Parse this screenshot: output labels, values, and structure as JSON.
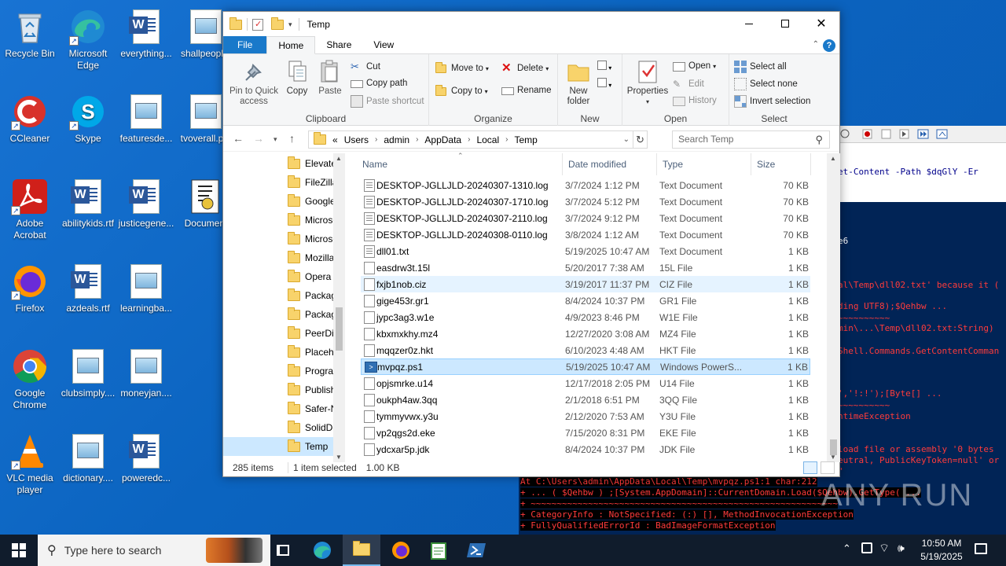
{
  "desktop": {
    "icons": [
      {
        "label": "Recycle Bin"
      },
      {
        "label": "Microsoft Edge"
      },
      {
        "label": "everything..."
      },
      {
        "label": "shallpeopl..."
      },
      {
        "label": "CCleaner"
      },
      {
        "label": "Skype"
      },
      {
        "label": "featuresde..."
      },
      {
        "label": "tvoverall.p..."
      },
      {
        "label": "Adobe Acrobat"
      },
      {
        "label": "abilitykids.rtf"
      },
      {
        "label": "justicegene..."
      },
      {
        "label": "Document"
      },
      {
        "label": "Firefox"
      },
      {
        "label": "azdeals.rtf"
      },
      {
        "label": "learningba..."
      },
      {
        "label": "Google Chrome"
      },
      {
        "label": "clubsimply...."
      },
      {
        "label": "moneyjan...."
      },
      {
        "label": "VLC media player"
      },
      {
        "label": "dictionary...."
      },
      {
        "label": "poweredc..."
      }
    ]
  },
  "powershell": {
    "code_line": "et-Content -Path $dqGlY -Er",
    "lines": [
      {
        "text": "e6",
        "cls": ""
      },
      {
        "text": "al\\Temp\\dll02.txt' because it (",
        "cls": "red"
      },
      {
        "text": "ding UTF8);$Qehbw ...",
        "cls": "red"
      },
      {
        "text": "~~~~~~~~~~",
        "cls": "red"
      },
      {
        "text": "min\\...\\Temp\\dll02.txt:String) ",
        "cls": "red"
      },
      {
        "text": "Shell.Commands.GetContentComman",
        "cls": "red"
      },
      {
        "text": "','!:!');[Byte[] ...",
        "cls": "red"
      },
      {
        "text": "~~~~~~~~~~",
        "cls": "red"
      },
      {
        "text": "ntimeException",
        "cls": "red"
      },
      {
        "text": "load file or assembly '0 bytes",
        "cls": "red"
      },
      {
        "text": "eutral, PublicKeyToken=null' or",
        "cls": "red"
      },
      {
        "text": "\"",
        "cls": "red"
      }
    ],
    "bottom_lines": [
      "At C:\\Users\\admin\\AppData\\Local\\Temp\\mvpqz.ps1:1 char:212",
      "+ ... ( $Qehbw ) ;[System.AppDomain]::CurrentDomain.Load($Qehbw).GetType( ...",
      "+                   ~~~~~~~~~~~~~~~~~~~~~~~~~~~~~~~~~~~~~~~~~~~~~~~~~~~~~~~~~~~",
      "    + CategoryInfo          : NotSpecified: (:) [], MethodInvocationException",
      "    + FullyQualifiedErrorId : BadImageFormatException",
      "",
      "PS C:\\Users\\admin\\AppData\\Local\\Temp>"
    ]
  },
  "explorer": {
    "title": "Temp",
    "tabs": [
      "File",
      "Home",
      "Share",
      "View"
    ],
    "ribbon": {
      "pin_quick_access": "Pin to Quick access",
      "copy": "Copy",
      "paste": "Paste",
      "cut": "Cut",
      "copy_path": "Copy path",
      "paste_shortcut": "Paste shortcut",
      "clipboard": "Clipboard",
      "move_to": "Move to",
      "copy_to": "Copy to",
      "delete": "Delete",
      "rename": "Rename",
      "organize": "Organize",
      "new_folder": "New folder",
      "new": "New",
      "properties": "Properties",
      "open": "Open",
      "edit": "Edit",
      "history": "History",
      "open_group": "Open",
      "select_all": "Select all",
      "select_none": "Select none",
      "invert_selection": "Invert selection",
      "select_group": "Select"
    },
    "breadcrumb": [
      "«",
      "Users",
      "admin",
      "AppData",
      "Local",
      "Temp"
    ],
    "search_placeholder": "Search Temp",
    "nav_items": [
      {
        "label": "Elevate"
      },
      {
        "label": "FileZilla"
      },
      {
        "label": "Google"
      },
      {
        "label": "Microso"
      },
      {
        "label": "Microso"
      },
      {
        "label": "Mozilla"
      },
      {
        "label": "Opera"
      },
      {
        "label": "Packag"
      },
      {
        "label": "Packag"
      },
      {
        "label": "PeerDis"
      },
      {
        "label": "Placeho"
      },
      {
        "label": "Prograr"
      },
      {
        "label": "Publish"
      },
      {
        "label": "Safer-N"
      },
      {
        "label": "SolidDc"
      },
      {
        "label": "Temp"
      }
    ],
    "columns": {
      "name": "Name",
      "date": "Date modified",
      "type": "Type",
      "size": "Size"
    },
    "files": [
      {
        "name": "DESKTOP-JGLLJLD-20240307-1310.log",
        "date": "3/7/2024 1:12 PM",
        "type": "Text Document",
        "size": "70 KB",
        "icon": "txt"
      },
      {
        "name": "DESKTOP-JGLLJLD-20240307-1710.log",
        "date": "3/7/2024 5:12 PM",
        "type": "Text Document",
        "size": "70 KB",
        "icon": "txt"
      },
      {
        "name": "DESKTOP-JGLLJLD-20240307-2110.log",
        "date": "3/7/2024 9:12 PM",
        "type": "Text Document",
        "size": "70 KB",
        "icon": "txt"
      },
      {
        "name": "DESKTOP-JGLLJLD-20240308-0110.log",
        "date": "3/8/2024 1:12 AM",
        "type": "Text Document",
        "size": "70 KB",
        "icon": "txt"
      },
      {
        "name": "dll01.txt",
        "date": "5/19/2025 10:47 AM",
        "type": "Text Document",
        "size": "1 KB",
        "icon": "txt"
      },
      {
        "name": "easdrw3t.15l",
        "date": "5/20/2017 7:38 AM",
        "type": "15L File",
        "size": "1 KB",
        "icon": "blank"
      },
      {
        "name": "fxjb1nob.ciz",
        "date": "3/19/2017 11:37 PM",
        "type": "CIZ File",
        "size": "1 KB",
        "icon": "blank"
      },
      {
        "name": "gige453r.gr1",
        "date": "8/4/2024 10:37 PM",
        "type": "GR1 File",
        "size": "1 KB",
        "icon": "blank"
      },
      {
        "name": "jypc3ag3.w1e",
        "date": "4/9/2023 8:46 PM",
        "type": "W1E File",
        "size": "1 KB",
        "icon": "blank"
      },
      {
        "name": "kbxmxkhy.mz4",
        "date": "12/27/2020 3:08 AM",
        "type": "MZ4 File",
        "size": "1 KB",
        "icon": "blank"
      },
      {
        "name": "mqqzer0z.hkt",
        "date": "6/10/2023 4:48 AM",
        "type": "HKT File",
        "size": "1 KB",
        "icon": "blank"
      },
      {
        "name": "mvpqz.ps1",
        "date": "5/19/2025 10:47 AM",
        "type": "Windows PowerS...",
        "size": "1 KB",
        "icon": "ps"
      },
      {
        "name": "opjsmrke.u14",
        "date": "12/17/2018 2:05 PM",
        "type": "U14 File",
        "size": "1 KB",
        "icon": "blank"
      },
      {
        "name": "oukph4aw.3qq",
        "date": "2/1/2018 6:51 PM",
        "type": "3QQ File",
        "size": "1 KB",
        "icon": "blank"
      },
      {
        "name": "tymmyvwx.y3u",
        "date": "2/12/2020 7:53 AM",
        "type": "Y3U File",
        "size": "1 KB",
        "icon": "blank"
      },
      {
        "name": "vp2qgs2d.eke",
        "date": "7/15/2020 8:31 PM",
        "type": "EKE File",
        "size": "1 KB",
        "icon": "blank"
      },
      {
        "name": "ydcxar5p.jdk",
        "date": "8/4/2024 10:37 PM",
        "type": "JDK File",
        "size": "1 KB",
        "icon": "blank"
      }
    ],
    "status": {
      "count": "285 items",
      "selected": "1 item selected",
      "size": "1.00 KB"
    }
  },
  "taskbar": {
    "search_placeholder": "Type here to search",
    "time": "10:50 AM",
    "date": "5/19/2025"
  },
  "watermark": "ANY RUN",
  "colors": {
    "accent": "#1979ca",
    "desktop": "#0b64c0",
    "ps_bg": "#012456",
    "error": "#ff3b3b"
  }
}
